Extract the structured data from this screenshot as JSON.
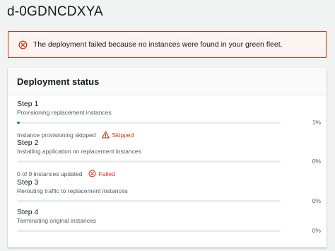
{
  "page": {
    "title": "d-0GDNCDXYA"
  },
  "alert": {
    "type": "error",
    "message": "The deployment failed because no instances were found in your green fleet.",
    "icon": "error-circle-icon"
  },
  "deployment_status": {
    "title": "Deployment status",
    "steps": [
      {
        "name": "Step 1",
        "description": "Provisioning replacement instances",
        "progress_label": "1%",
        "progress_fraction": 0.01,
        "status_detail": "Instance provisioning skipped",
        "status_label": "Skipped",
        "status_icon": "warning-triangle-icon"
      },
      {
        "name": "Step 2",
        "description": "Installing application on replacement instances",
        "progress_label": "0%",
        "progress_fraction": 0,
        "status_detail": "0 of 0 instances updated",
        "status_label": "Failed",
        "status_icon": "error-circle-icon"
      },
      {
        "name": "Step 3",
        "description": "Rerouting traffic to replacement instances",
        "progress_label": "0%",
        "progress_fraction": 0
      },
      {
        "name": "Step 4",
        "description": "Terminating original instances",
        "progress_label": "0%",
        "progress_fraction": 0
      }
    ]
  },
  "colors": {
    "error": "#d13212",
    "progress": "#0073bb",
    "track": "#eaeded"
  }
}
